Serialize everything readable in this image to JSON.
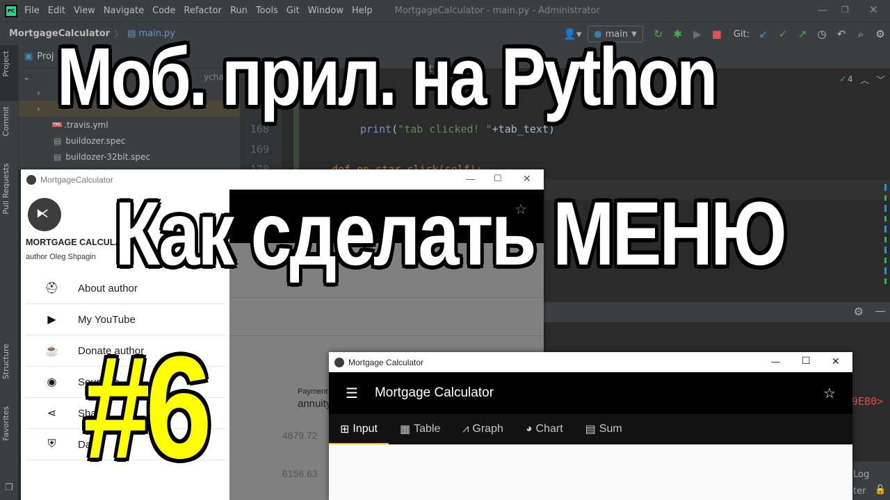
{
  "ide": {
    "menu": [
      "File",
      "Edit",
      "View",
      "Navigate",
      "Code",
      "Refactor",
      "Run",
      "Tools",
      "Git",
      "Window",
      "Help"
    ],
    "window_title": "MortgageCalculator - main.py - Administrator",
    "breadcrumb": {
      "project": "MortgageCalculator",
      "file": "main.py"
    },
    "run_config": "main",
    "git_label": "Git:",
    "tool_tabs": {
      "project": "Project",
      "commit": "Commit",
      "pull_requests": "Pull Requests",
      "structure": "Structure",
      "favorites": "Favorites"
    },
    "project_header": "Proj",
    "tree": [
      ".travis.yml",
      "buildozer.spec",
      "buildozer-32bit.spec"
    ],
    "tree_partial": "ycharm",
    "inspection_count": "4",
    "line_numbers": [
      "168",
      "169",
      "170"
    ],
    "code": {
      "line_167_partial": "text",
      "line_168": "print(\"tab clicked! \"+tab_text)",
      "line_170": "def on_star_click(self):"
    },
    "console_fragment": "9EB0>",
    "bottom_labels": [
      "Log",
      "ter"
    ]
  },
  "drawer_window": {
    "title": "MortgageCalculator",
    "app_name": "MORTGAGE CALCULA",
    "author": "author Oleg Shpagin",
    "items": [
      {
        "icon": "cowboy-icon",
        "label": "About author"
      },
      {
        "icon": "youtube-icon",
        "label": "My YouTube"
      },
      {
        "icon": "coffee-icon",
        "label": "Donate author"
      },
      {
        "icon": "github-icon",
        "label": "Source c"
      },
      {
        "icon": "share-icon",
        "label": "Share"
      },
      {
        "icon": "shield-icon",
        "label": "Da"
      }
    ],
    "table": {
      "header_top": "Payment",
      "header_bottom": "annuity",
      "values": [
        "4679.72",
        "6156.63"
      ]
    }
  },
  "main_window": {
    "title": "Mortgage Calculator",
    "appbar_title": "Mortgage Calculator",
    "tabs": [
      {
        "icon": "calculator-icon",
        "label": "Input",
        "active": true
      },
      {
        "icon": "table-icon",
        "label": "Table",
        "active": false
      },
      {
        "icon": "graph-icon",
        "label": "Graph",
        "active": false
      },
      {
        "icon": "pie-chart-icon",
        "label": "Chart",
        "active": false
      },
      {
        "icon": "book-icon",
        "label": "Sum",
        "active": false
      }
    ],
    "accent": "#f5c518"
  },
  "overlay": {
    "line1": "Моб. прил. на Python",
    "line2": "Как сделать МЕНЮ",
    "line3": "#6",
    "line3_color": "#ffff00"
  }
}
